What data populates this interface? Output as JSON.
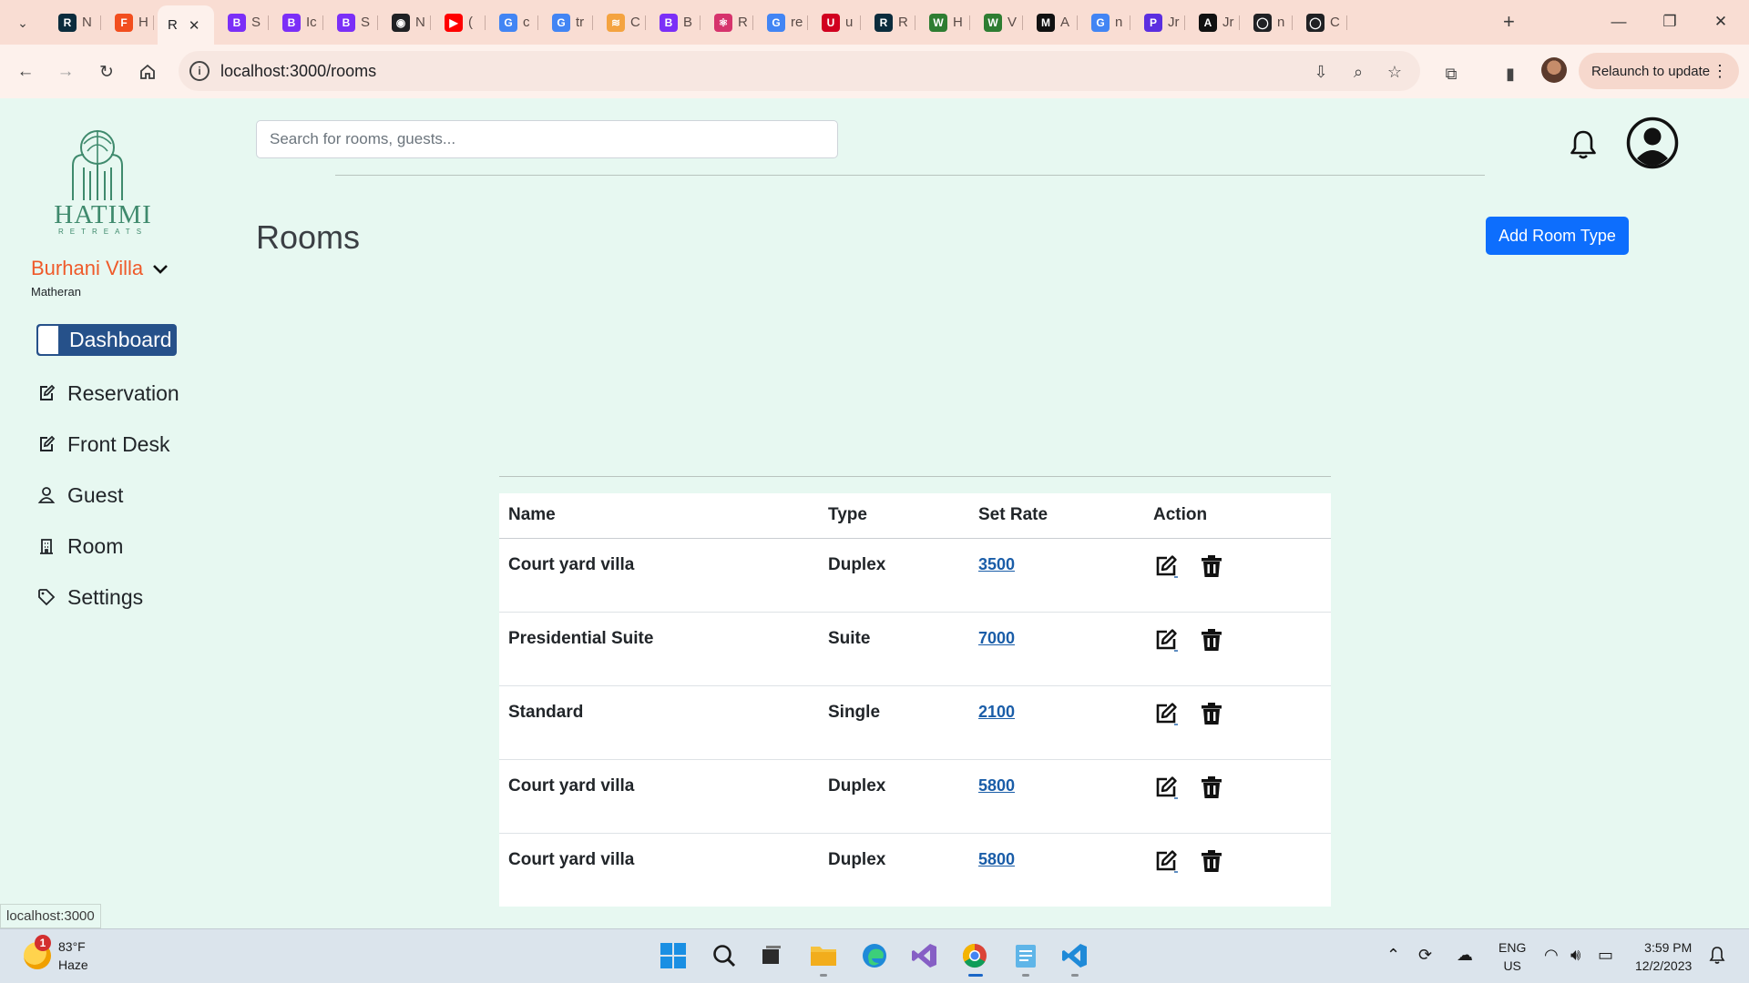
{
  "browser": {
    "tabs": [
      {
        "label": "N",
        "fav": "R",
        "color": "#0b2c3d"
      },
      {
        "label": "H",
        "fav": "F",
        "color": "#f24e1e"
      },
      {
        "label": "R",
        "fav": "",
        "color": "",
        "active": true
      },
      {
        "label": "S",
        "fav": "B",
        "color": "#7b2ff7"
      },
      {
        "label": "Ic",
        "fav": "B",
        "color": "#7b2ff7"
      },
      {
        "label": "S",
        "fav": "B",
        "color": "#7b2ff7"
      },
      {
        "label": "N",
        "fav": "◉",
        "color": "#202124"
      },
      {
        "label": "(",
        "fav": "▶",
        "color": "#ff0000"
      },
      {
        "label": "c",
        "fav": "G",
        "color": "#4285f4"
      },
      {
        "label": "tr",
        "fav": "G",
        "color": "#4285f4"
      },
      {
        "label": "C",
        "fav": "≋",
        "color": "#f4a340"
      },
      {
        "label": "B",
        "fav": "B",
        "color": "#7b2ff7"
      },
      {
        "label": "R",
        "fav": "⚛",
        "color": "#d6336c"
      },
      {
        "label": "re",
        "fav": "G",
        "color": "#4285f4"
      },
      {
        "label": "u",
        "fav": "U",
        "color": "#d1001f"
      },
      {
        "label": "R",
        "fav": "R",
        "color": "#0b2c3d"
      },
      {
        "label": "H",
        "fav": "W",
        "color": "#2e7d32"
      },
      {
        "label": "V",
        "fav": "W",
        "color": "#2e7d32"
      },
      {
        "label": "A",
        "fav": "M",
        "color": "#111111"
      },
      {
        "label": "n",
        "fav": "G",
        "color": "#4285f4"
      },
      {
        "label": "Jr",
        "fav": "P",
        "color": "#5b2ee0"
      },
      {
        "label": "Jr",
        "fav": "A",
        "color": "#111111"
      },
      {
        "label": "n",
        "fav": "◯",
        "color": "#202124"
      },
      {
        "label": "C",
        "fav": "◯",
        "color": "#202124"
      }
    ],
    "close_glyph": "✕",
    "new_tab_glyph": "+",
    "url": "localhost:3000/rooms",
    "relaunch_label": "Relaunch to update",
    "status_tip": "localhost:3000"
  },
  "sidebar": {
    "brand_name": "HATIMI",
    "brand_sub": "RETREATS",
    "property_name": "Burhani Villa",
    "property_location": "Matheran",
    "nav": [
      {
        "label": "Dashboard",
        "icon": "blank-icon",
        "active": true
      },
      {
        "label": "Reservation",
        "icon": "edit-icon"
      },
      {
        "label": "Front Desk",
        "icon": "edit-icon"
      },
      {
        "label": "Guest",
        "icon": "person-icon"
      },
      {
        "label": "Room",
        "icon": "building-icon"
      },
      {
        "label": "Settings",
        "icon": "tag-icon"
      }
    ]
  },
  "header": {
    "search_placeholder": "Search for rooms, guests..."
  },
  "main": {
    "title": "Rooms",
    "add_button": "Add Room Type",
    "table": {
      "headers": [
        "Name",
        "Type",
        "Set Rate",
        "Action"
      ],
      "rows": [
        {
          "name": "Court yard villa",
          "type": "Duplex",
          "rate": "3500"
        },
        {
          "name": "Presidential Suite",
          "type": "Suite",
          "rate": "7000"
        },
        {
          "name": "Standard",
          "type": "Single",
          "rate": "2100"
        },
        {
          "name": "Court yard villa",
          "type": "Duplex",
          "rate": "5800"
        },
        {
          "name": "Court yard villa",
          "type": "Duplex",
          "rate": "5800"
        }
      ]
    }
  },
  "taskbar": {
    "weather_badge": "1",
    "temperature": "83°F",
    "condition": "Haze",
    "lang_top": "ENG",
    "lang_bottom": "US",
    "time": "3:59 PM",
    "date": "12/2/2023"
  },
  "colors": {
    "accent": "#0d6efd",
    "property": "#ef5a2a",
    "active_nav": "#26518a",
    "page_bg": "#e7f8f1"
  }
}
